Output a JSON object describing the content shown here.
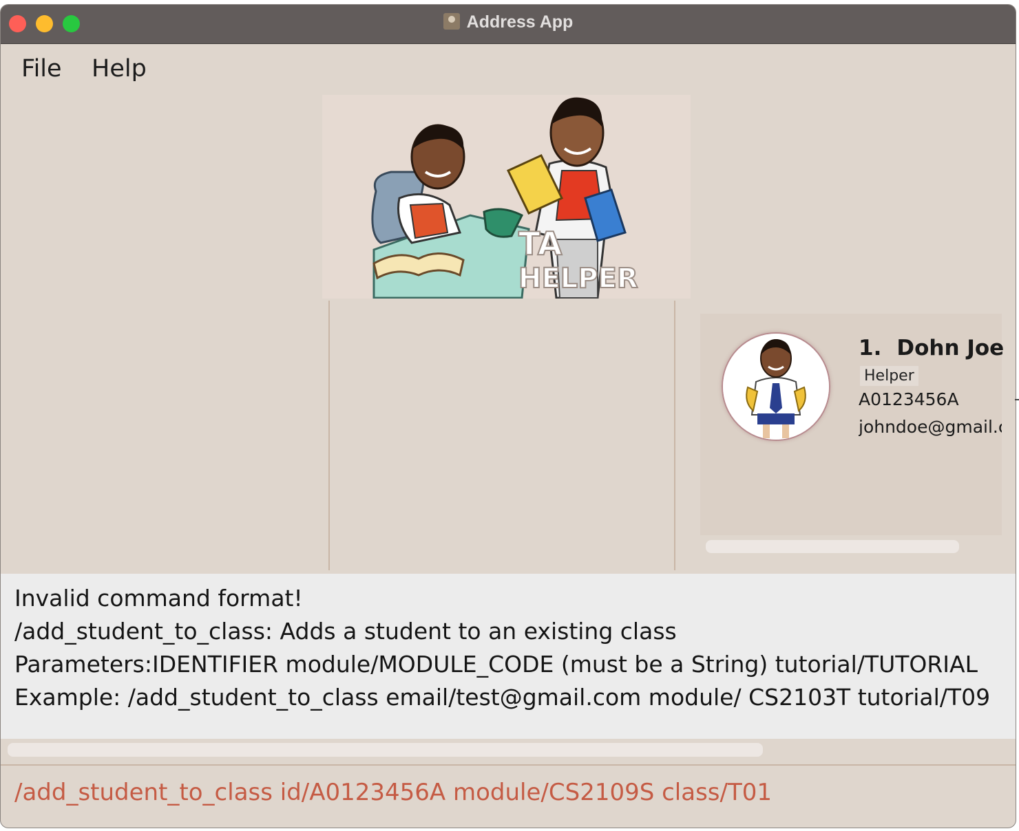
{
  "window": {
    "title": "Address App"
  },
  "menu": {
    "file": "File",
    "help": "Help"
  },
  "banner": {
    "logo_text_1": "TA",
    "logo_text_2": "HELPER"
  },
  "person_list": [
    {
      "index": "1.",
      "name": "Dohn Joe",
      "tag": "Helper",
      "id": "A0123456A",
      "email": "johndoe@gmail.com"
    }
  ],
  "result": {
    "lines": [
      "Invalid command format!",
      "/add_student_to_class: Adds a student to an existing class",
      "Parameters:IDENTIFIER module/MODULE_CODE (must be a String) tutorial/TUTORIAL",
      "Example: /add_student_to_class email/test@gmail.com module/ CS2103T tutorial/T09"
    ]
  },
  "command": {
    "value": "/add_student_to_class id/A0123456A module/CS2109S class/T01"
  },
  "colors": {
    "command_error": "#c55b44",
    "background": "#dfd6cd",
    "titlebar": "#625c5b"
  }
}
